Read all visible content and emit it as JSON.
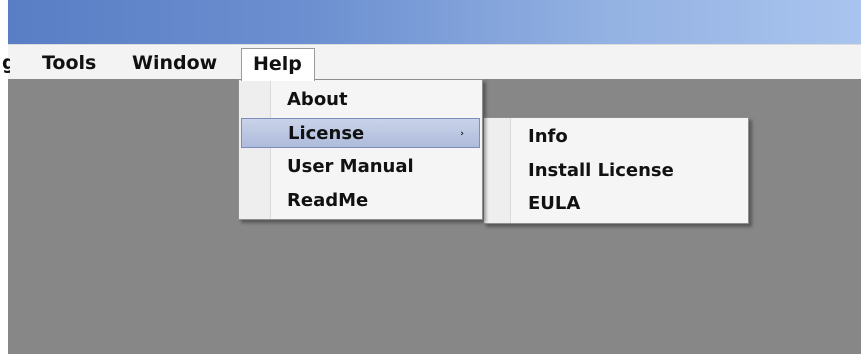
{
  "menubar": {
    "partial_item": "g",
    "tools": "Tools",
    "window": "Window",
    "help": "Help"
  },
  "help_menu": {
    "items": [
      "About",
      "License",
      "User Manual",
      "ReadMe"
    ],
    "highlighted": "License",
    "submenu_arrow": "›"
  },
  "license_submenu": {
    "items": [
      "Info",
      "Install License",
      "EULA"
    ]
  },
  "colors": {
    "titlebar_start": "#5a7ec4",
    "titlebar_end": "#a9c4ee",
    "workspace": "#878787",
    "highlight": "#b9c6e2"
  },
  "icons": {
    "submenu_arrow": "chevron-right-icon"
  }
}
